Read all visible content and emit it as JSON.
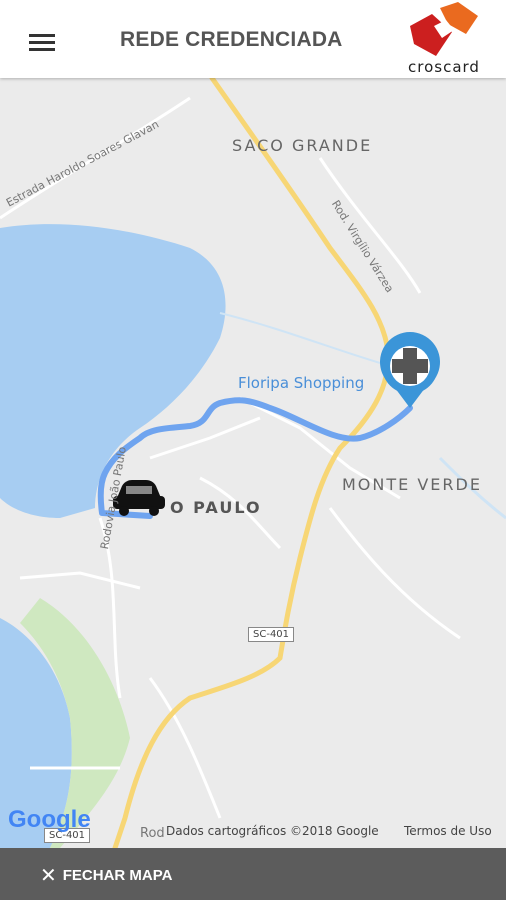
{
  "header": {
    "title": "REDE CREDENCIADA",
    "menu_icon": "hamburger-menu-icon",
    "logo_text": "croscard",
    "logo_colors": [
      "#e8501e",
      "#cc1c1c"
    ]
  },
  "map": {
    "districts": [
      "SACO GRANDE",
      "MONTE VERDE",
      "O PAULO"
    ],
    "streets": [
      "Estrada Haroldo Soares Glavan",
      "Rod. Virgílio Várzea",
      "Rodovia João Paulo",
      "Rod"
    ],
    "highway_shields": [
      "SC-401",
      "SC-401"
    ],
    "poi_label": "Floripa Shopping",
    "destination_icon": "medical-cross-pin-icon",
    "origin_icon": "car-icon",
    "route_color": "#6fa4ef",
    "water_color": "#a5ccf2",
    "road_color": "#f7d675",
    "google_logo": "Google",
    "attribution": "Dados cartográficos ©2018 Google",
    "terms": "Termos de Uso"
  },
  "footer": {
    "close_icon": "close-icon",
    "close_label": "FECHAR MAPA"
  }
}
